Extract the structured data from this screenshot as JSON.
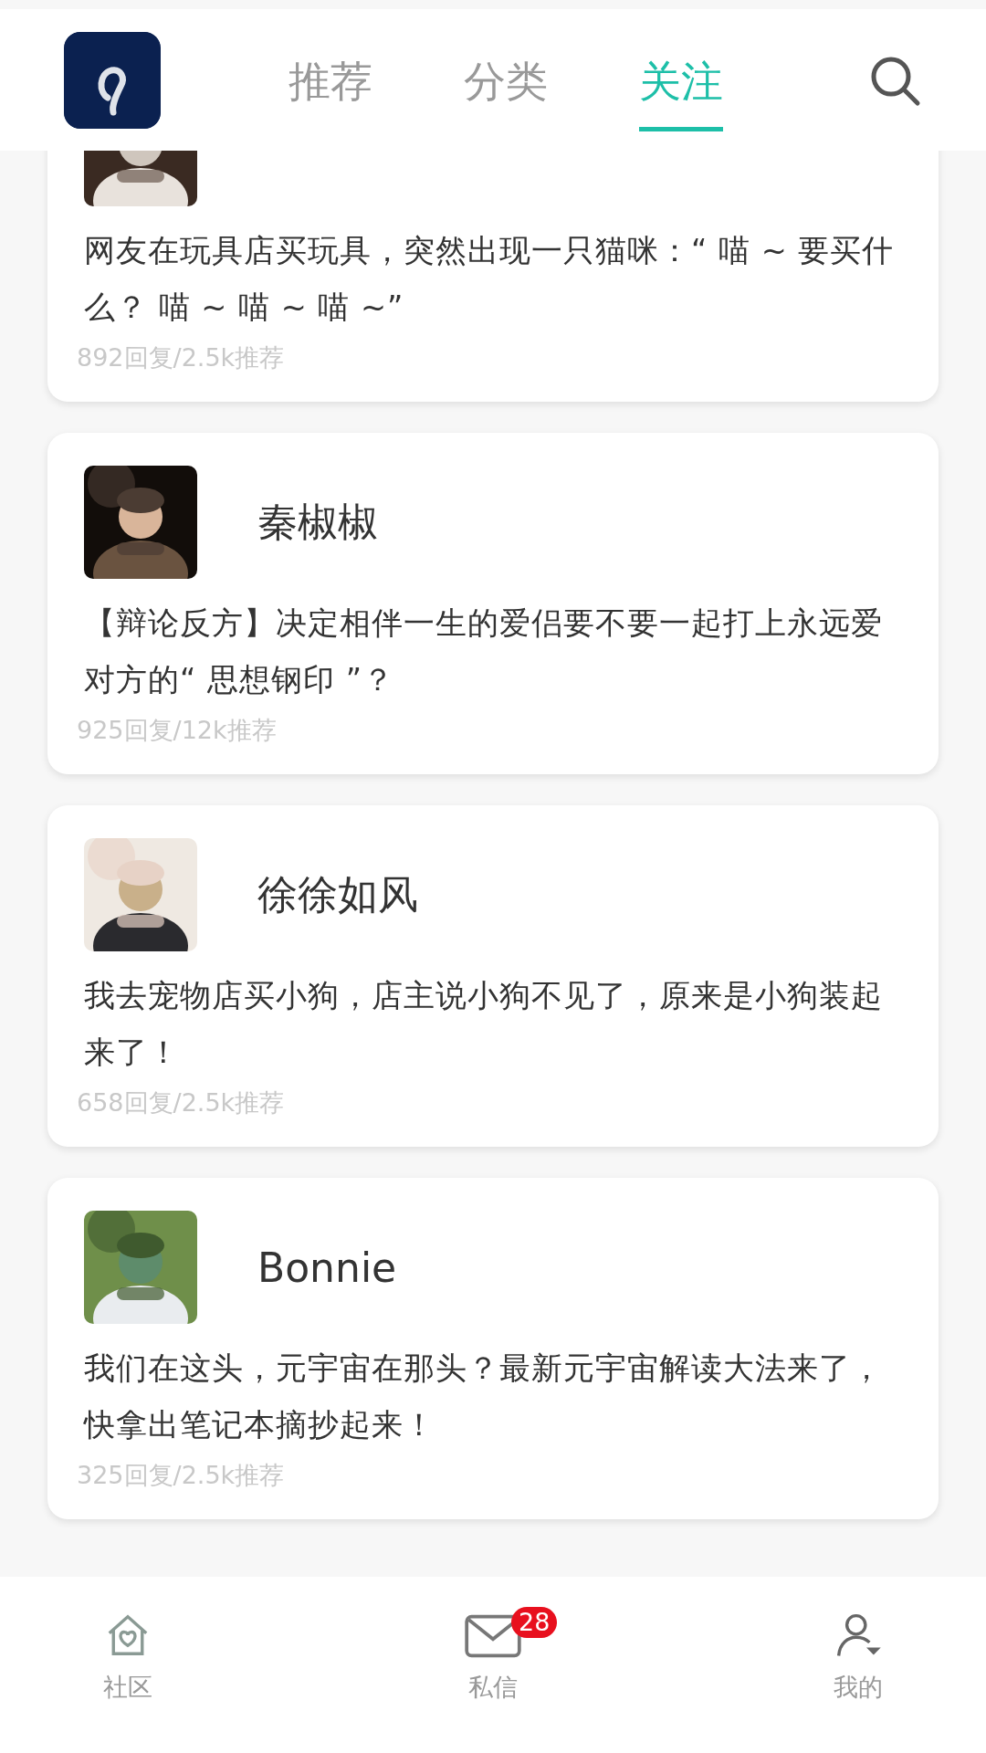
{
  "header": {
    "tabs": [
      {
        "label": "推荐",
        "selected": false
      },
      {
        "label": "分类",
        "selected": false
      },
      {
        "label": "关注",
        "selected": true
      }
    ]
  },
  "posts": [
    {
      "text": "网友在玩具店买玩具，突然出现一只猫咪：“ 喵 ~ 要买什么？ 喵 ~ 喵 ~ 喵 ~”",
      "stats": "892回复/2.5k推荐"
    },
    {
      "name": "秦椒椒",
      "text": "【辩论反方】决定相伴一生的爱侣要不要一起打上永远爱对方的“ 思想钢印 ”？",
      "stats": "925回复/12k推荐"
    },
    {
      "name": "徐徐如风",
      "text": "我去宠物店买小狗，店主说小狗不见了，原来是小狗装起来了！",
      "stats": "658回复/2.5k推荐"
    },
    {
      "name": "Bonnie",
      "text": "我们在这头，元宇宙在那头？最新元宇宙解读大法来了，快拿出笔记本摘抄起来！",
      "stats": "325回复/2.5k推荐"
    }
  ],
  "bottom_nav": [
    {
      "kind": "home",
      "label": "社区"
    },
    {
      "kind": "mail",
      "label": "私信",
      "badge": "28"
    },
    {
      "kind": "profile",
      "label": "我的"
    }
  ]
}
